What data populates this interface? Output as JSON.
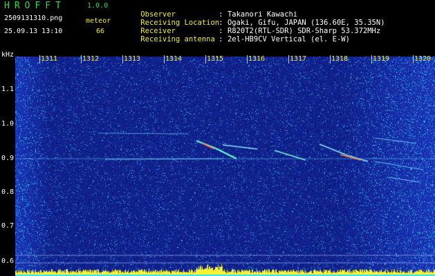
{
  "header": {
    "brand": "HROFFT",
    "version": "1.0.0",
    "filename": "2509131310.png",
    "datetime": "25.09.13 13:10",
    "meteor_label": "meteor",
    "meteor_count": "66"
  },
  "info": [
    {
      "key": "Observer",
      "value": ": Takanori Kawachi"
    },
    {
      "key": "Receiving Location",
      "value": ": Ogaki, Gifu, JAPAN (136.60E, 35.35N)"
    },
    {
      "key": "Receiver",
      "value": ": R820T2(RTL-SDR) SDR-Sharp 53.372MHz"
    },
    {
      "key": "Receiving antenna",
      "value": ": 2el-HB9CV Vertical (el. E-W)"
    }
  ],
  "axis": {
    "unit": "kHz",
    "time_ticks": [
      "1311",
      "1312",
      "1313",
      "1314",
      "1315",
      "1316",
      "1317",
      "1318",
      "1319",
      "1320"
    ],
    "freq_ticks": [
      "1.1",
      "1.0",
      "0.9",
      "0.8",
      "0.7",
      "0.6"
    ]
  },
  "colors": {
    "background": "#000000",
    "brand_green": "#22e14a",
    "label_yellow": "#f4ec2a",
    "spectrum_base": "#1a2f9c"
  }
}
